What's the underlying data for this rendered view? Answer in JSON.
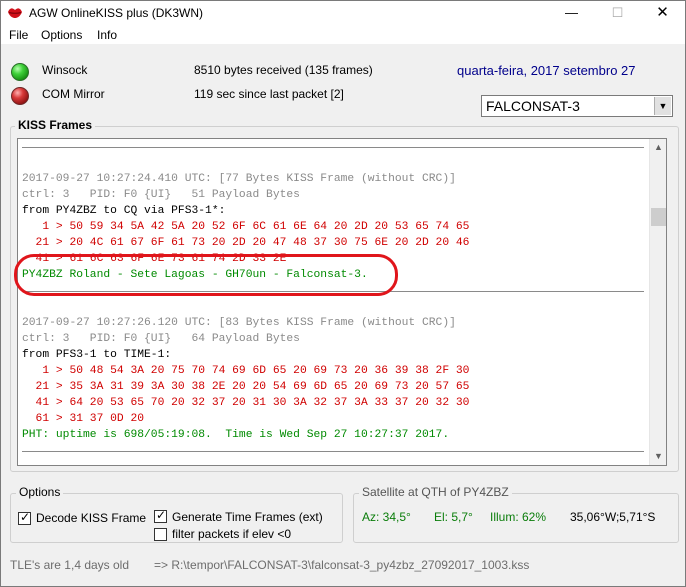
{
  "window": {
    "title": "AGW OnlineKISS plus (DK3WN)",
    "minimize": "—",
    "maximize": "☐",
    "close": "✕"
  },
  "menu": [
    "File",
    "Options",
    "Info"
  ],
  "status": {
    "winsock": {
      "label": "Winsock",
      "info": "8510 bytes received (135 frames)",
      "color": "#3fd13a"
    },
    "com": {
      "label": "COM Mirror",
      "info": "119 sec since last packet [2]",
      "color": "#d83a3a"
    }
  },
  "date": "quarta-feira, 2017 setembro 27",
  "satellite_select": {
    "value": "FALCONSAT-3",
    "arrow": "▼"
  },
  "kiss_frames": {
    "label": "KISS Frames",
    "lines": [
      {
        "text": "",
        "style": "sep"
      },
      {
        "text": "",
        "style": "blank"
      },
      {
        "text": "2017-09-27 10:27:24.410 UTC: [77 Bytes KISS Frame (without CRC)]",
        "style": "gray"
      },
      {
        "text": "ctrl: 3   PID: F0 {UI}   51 Payload Bytes",
        "style": "gray"
      },
      {
        "text": "from PY4ZBZ to CQ via PFS3-1*:",
        "style": "black"
      },
      {
        "text": "   1 > 50 59 34 5A 42 5A 20 52 6F 6C 61 6E 64 20 2D 20 53 65 74 65",
        "style": "red"
      },
      {
        "text": "  21 > 20 4C 61 67 6F 61 73 20 2D 20 47 48 37 30 75 6E 20 2D 20 46",
        "style": "red"
      },
      {
        "text": "  41 > 61 6C 63 6F 6E 73 61 74 2D 33 2E",
        "style": "red"
      },
      {
        "text": "PY4ZBZ Roland - Sete Lagoas - GH70un - Falconsat-3.",
        "style": "green"
      },
      {
        "text": "",
        "style": "sep"
      },
      {
        "text": "",
        "style": "blank"
      },
      {
        "text": "2017-09-27 10:27:26.120 UTC: [83 Bytes KISS Frame (without CRC)]",
        "style": "gray"
      },
      {
        "text": "ctrl: 3   PID: F0 {UI}   64 Payload Bytes",
        "style": "gray"
      },
      {
        "text": "from PFS3-1 to TIME-1:",
        "style": "black"
      },
      {
        "text": "   1 > 50 48 54 3A 20 75 70 74 69 6D 65 20 69 73 20 36 39 38 2F 30",
        "style": "red"
      },
      {
        "text": "  21 > 35 3A 31 39 3A 30 38 2E 20 20 54 69 6D 65 20 69 73 20 57 65",
        "style": "red"
      },
      {
        "text": "  41 > 64 20 53 65 70 20 32 37 20 31 30 3A 32 37 3A 33 37 20 32 30",
        "style": "red"
      },
      {
        "text": "  61 > 31 37 0D 20",
        "style": "red"
      },
      {
        "text": "PHT: uptime is 698/05:19:08.  Time is Wed Sep 27 10:27:37 2017.",
        "style": "green"
      },
      {
        "text": "",
        "style": "sep"
      }
    ],
    "scroll_up": "▲",
    "scroll_down": "▼"
  },
  "options": {
    "label": "Options",
    "decode": {
      "label": "Decode KISS Frame",
      "checked": true
    },
    "generate": {
      "label": "Generate Time Frames (ext)",
      "checked": true
    },
    "filter": {
      "label": "filter packets if elev <0",
      "checked": false
    },
    "checkmark": "✓"
  },
  "satellite_qth": {
    "label": "Satellite at QTH of PY4ZBZ",
    "az": "Az: 34,5°",
    "el": "El: 5,7°",
    "illum": "Illum: 62%",
    "coords": "35,06°W;5,71°S"
  },
  "footer": {
    "tle": "TLE's are 1,4 days old",
    "path": "=> R:\\tempor\\FALCONSAT-3\\falconsat-3_py4zbz_27092017_1003.kss"
  }
}
